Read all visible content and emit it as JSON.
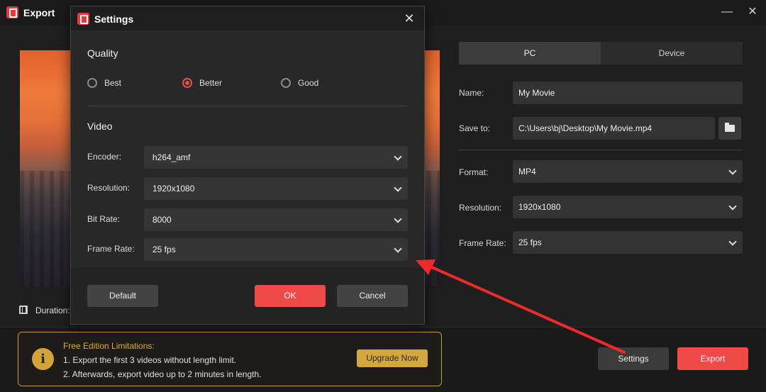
{
  "window": {
    "title": "Export",
    "minimize_label": "—",
    "close_label": "✕"
  },
  "preview": {
    "duration_label": "Duration:"
  },
  "export_panel": {
    "tabs": [
      {
        "label": "PC"
      },
      {
        "label": "Device"
      }
    ],
    "name_label": "Name:",
    "name_value": "My Movie",
    "save_to_label": "Save to:",
    "save_to_value": "C:\\Users\\bj\\Desktop\\My Movie.mp4",
    "format_label": "Format:",
    "format_value": "MP4",
    "resolution_label": "Resolution:",
    "resolution_value": "1920x1080",
    "frame_rate_label": "Frame Rate:",
    "frame_rate_value": "25 fps"
  },
  "limitations": {
    "title": "Free Edition Limitations:",
    "line1": "1. Export the first 3 videos without length limit.",
    "line2": "2. Afterwards, export video up to 2 minutes in length.",
    "upgrade_label": "Upgrade Now",
    "info_glyph": "i"
  },
  "actions": {
    "settings_label": "Settings",
    "export_label": "Export"
  },
  "settings_dialog": {
    "title": "Settings",
    "close_label": "✕",
    "quality_heading": "Quality",
    "quality_options": [
      {
        "label": "Best",
        "selected": false
      },
      {
        "label": "Better",
        "selected": true
      },
      {
        "label": "Good",
        "selected": false
      }
    ],
    "video_heading": "Video",
    "encoder_label": "Encoder:",
    "encoder_value": "h264_amf",
    "resolution_label": "Resolution:",
    "resolution_value": "1920x1080",
    "bitrate_label": "Bit Rate:",
    "bitrate_value": "8000",
    "frame_rate_label": "Frame Rate:",
    "frame_rate_value": "25 fps",
    "default_label": "Default",
    "ok_label": "OK",
    "cancel_label": "Cancel"
  },
  "colors": {
    "accent": "#ef4a48",
    "warning": "#d3a63e",
    "annotation_arrow": "#f02a2a"
  }
}
